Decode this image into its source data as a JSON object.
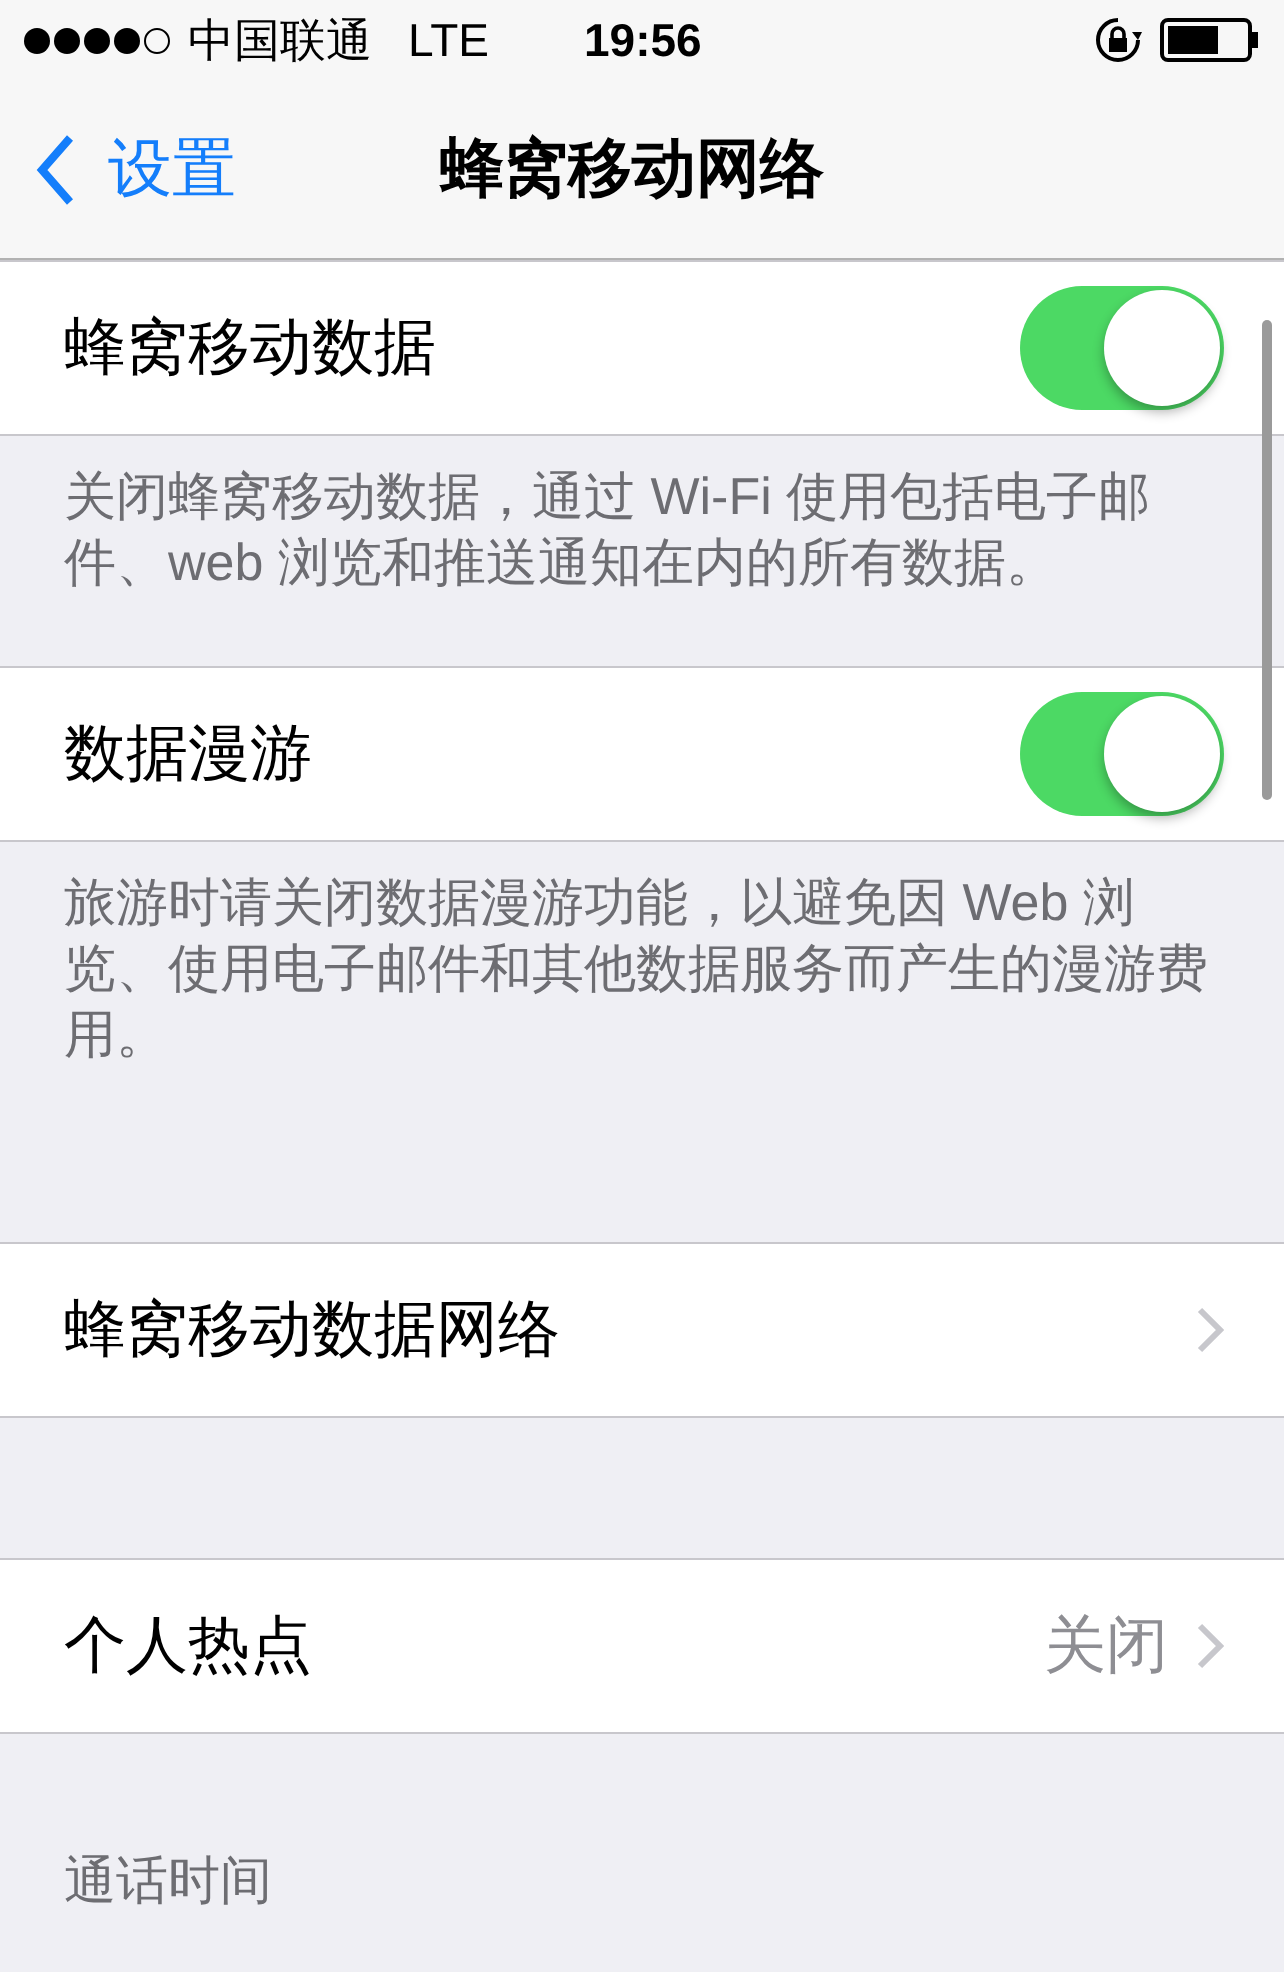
{
  "status_bar": {
    "carrier": "中国联通",
    "network": "LTE",
    "time": "19:56"
  },
  "nav": {
    "back_label": "设置",
    "title": "蜂窝移动网络"
  },
  "groups": [
    {
      "rows": [
        {
          "kind": "toggle",
          "label": "蜂窝移动数据",
          "on": true
        }
      ],
      "footer": "关闭蜂窝移动数据，通过 Wi-Fi 使用包括电子邮件、web 浏览和推送通知在内的所有数据。"
    },
    {
      "rows": [
        {
          "kind": "toggle",
          "label": "数据漫游",
          "on": true
        }
      ],
      "footer": "旅游时请关闭数据漫游功能，以避免因 Web 浏览、使用电子邮件和其他数据服务而产生的漫游费用。"
    },
    {
      "rows": [
        {
          "kind": "disclosure",
          "label": "蜂窝移动数据网络"
        }
      ]
    },
    {
      "rows": [
        {
          "kind": "disclosure",
          "label": "个人热点",
          "value": "关闭"
        }
      ]
    }
  ],
  "section_header": "通话时间"
}
